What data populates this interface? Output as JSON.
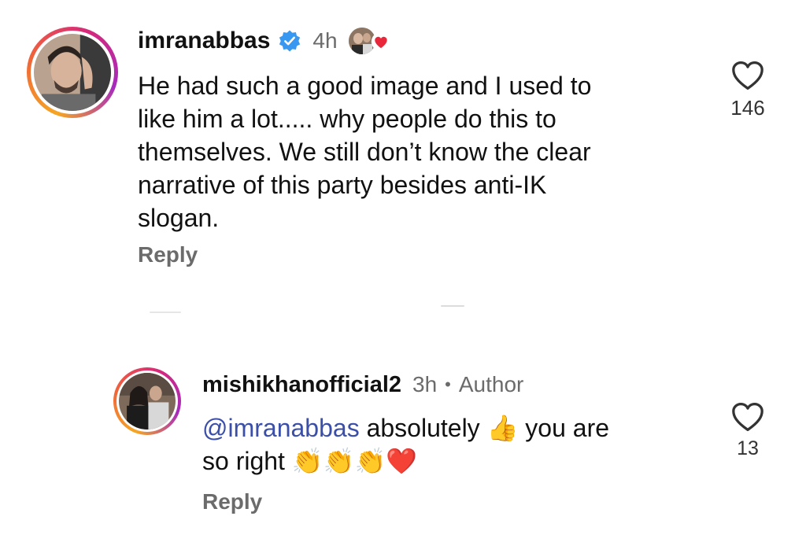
{
  "comments": [
    {
      "username": "imranabbas",
      "verified": true,
      "time": "4h",
      "text": "He had such a good image and I used to\nlike him a lot..... why people do this to\nthemselves. We still don’t know the clear\nnarrative of this party besides anti-IK\nslogan.",
      "reply_label": "Reply",
      "like_count": "146",
      "liked_by_author": true
    },
    {
      "username": "mishikhanofficial2",
      "time": "3h",
      "separator": "•",
      "badge": "Author",
      "mention": "@imranabbas",
      "text_part1": " absolutely ",
      "emoji_thumbs": "👍",
      "text_part2": " you are\nso right ",
      "emoji_claps": "👏👏👏",
      "emoji_heart": "❤️",
      "reply_label": "Reply",
      "like_count": "13"
    }
  ],
  "icons": {
    "verified": "verified-badge-icon",
    "like": "heart-outline-icon",
    "author_like": "heart-filled-icon"
  },
  "colors": {
    "verified_blue": "#3897f0",
    "mention_blue": "#3b4fa8",
    "secondary_text": "#6b6b6b",
    "heart_red": "#e8283a"
  }
}
